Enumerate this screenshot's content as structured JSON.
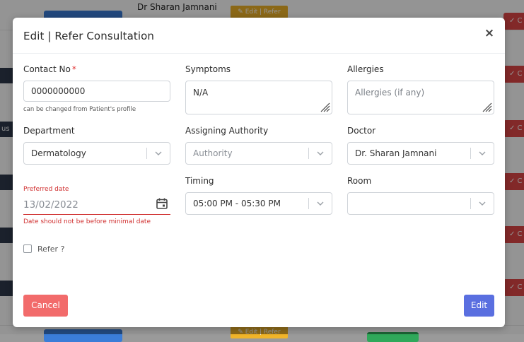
{
  "background": {
    "doctor_name": "Dr Sharan Jamnani",
    "refer_button_label": "✎ Edit | Refer",
    "side_text": "us",
    "red_button_label": "✓ C"
  },
  "modal": {
    "title": "Edit | Refer Consultation",
    "close_label": "×",
    "contact": {
      "label": "Contact No",
      "required_mark": "*",
      "value": "0000000000",
      "hint": "can be changed from Patient's profile"
    },
    "symptoms": {
      "label": "Symptoms",
      "value": "N/A"
    },
    "allergies": {
      "label": "Allergies",
      "placeholder": "Allergies (if any)"
    },
    "department": {
      "label": "Department",
      "value": "Dermatology"
    },
    "assigning_authority": {
      "label": "Assigning Authority",
      "placeholder": "Authority"
    },
    "doctor": {
      "label": "Doctor",
      "value": "Dr. Sharan Jamnani"
    },
    "preferred_date": {
      "label": "Preferred date",
      "value": "13/02/2022",
      "error": "Date should not be before minimal date"
    },
    "timing": {
      "label": "Timing",
      "value": "05:00 PM - 05:30 PM"
    },
    "room": {
      "label": "Room",
      "value": ""
    },
    "refer": {
      "label": "Refer ?",
      "checked": false
    },
    "buttons": {
      "cancel": "Cancel",
      "edit": "Edit"
    }
  },
  "icons": {
    "close": "close-icon",
    "calendar": "calendar-icon",
    "chevron": "chevron-down-icon",
    "resize": "resize-grip-icon"
  },
  "colors": {
    "cancel": "#f26b6b",
    "edit": "#5a6fe0",
    "error": "#d03030",
    "required": "#e03131"
  }
}
